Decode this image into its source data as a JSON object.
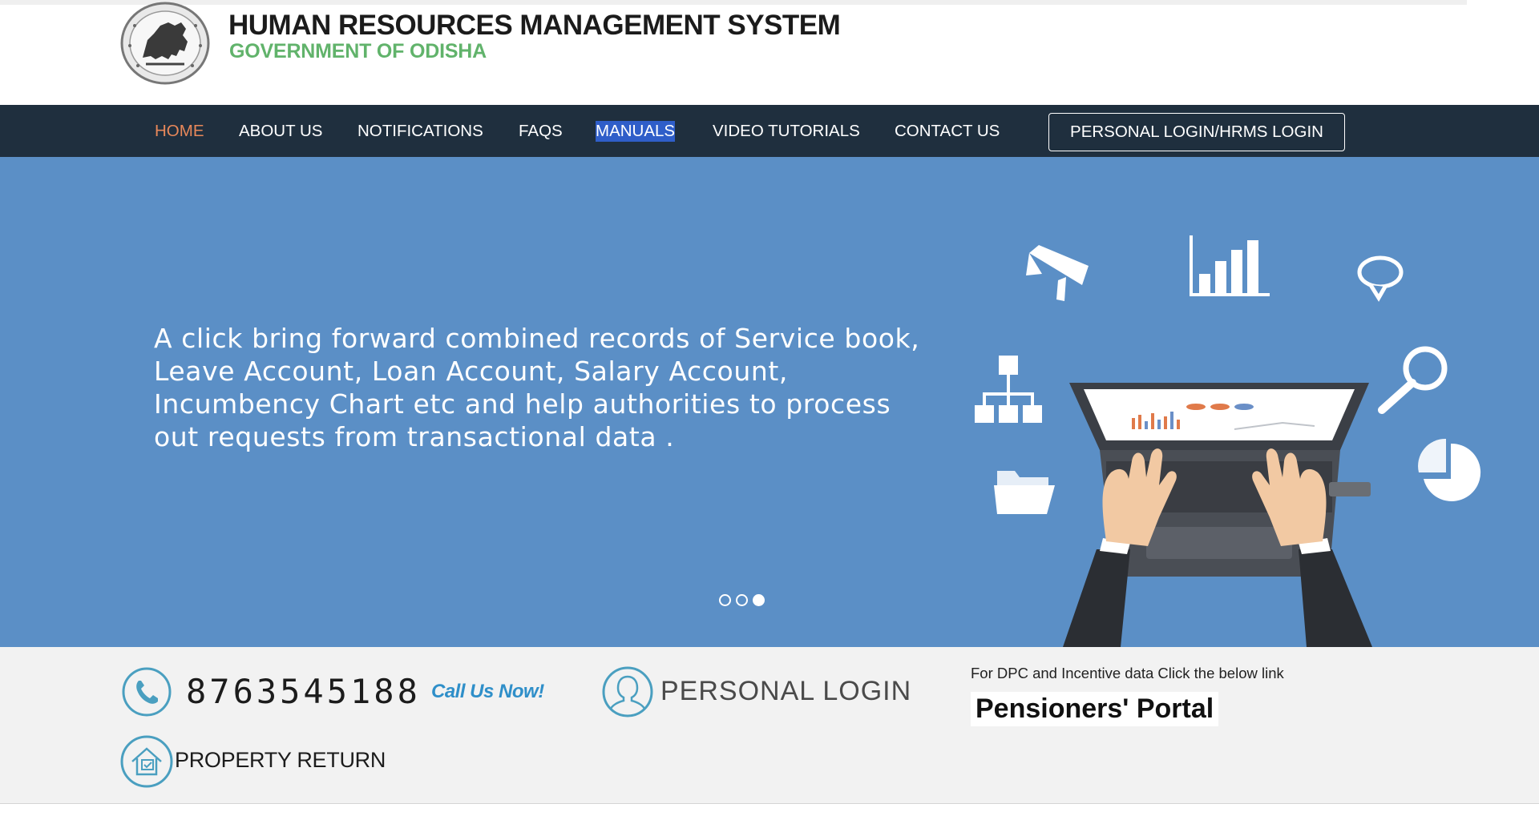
{
  "header": {
    "title": "HUMAN RESOURCES MANAGEMENT SYSTEM",
    "subtitle": "GOVERNMENT OF ODISHA",
    "emblem_icon": "odisha-emblem-icon"
  },
  "nav": {
    "items": [
      {
        "label": "HOME",
        "active": true
      },
      {
        "label": "ABOUT US"
      },
      {
        "label": "NOTIFICATIONS"
      },
      {
        "label": "FAQS"
      },
      {
        "label": "MANUALS",
        "selected": true
      },
      {
        "label": "VIDEO TUTORIALS"
      },
      {
        "label": "CONTACT US"
      }
    ],
    "login_button": "PERSONAL LOGIN/HRMS LOGIN"
  },
  "banner": {
    "text": "A click bring forward combined records of Service book, Leave Account, Loan Account, Salary Account, Incumbency Chart etc and help authorities to process out requests from transactional data .",
    "slide_count": 3,
    "active_slide": 3
  },
  "info": {
    "phone": "8763545188",
    "call_now": "Call Us Now!",
    "personal_login": "PERSONAL LOGIN",
    "dpc_text": "For DPC and Incentive data Click the below link",
    "pensioners_portal": "Pensioners' Portal",
    "property_return": "PROPERTY RETURN"
  },
  "colors": {
    "nav_bg": "#1f2f3e",
    "nav_active": "#e8885a",
    "banner_bg": "#5b8fc6",
    "subtitle_green": "#61b36b",
    "call_now_blue": "#2f8fc9",
    "icon_teal": "#4a9fc0"
  }
}
